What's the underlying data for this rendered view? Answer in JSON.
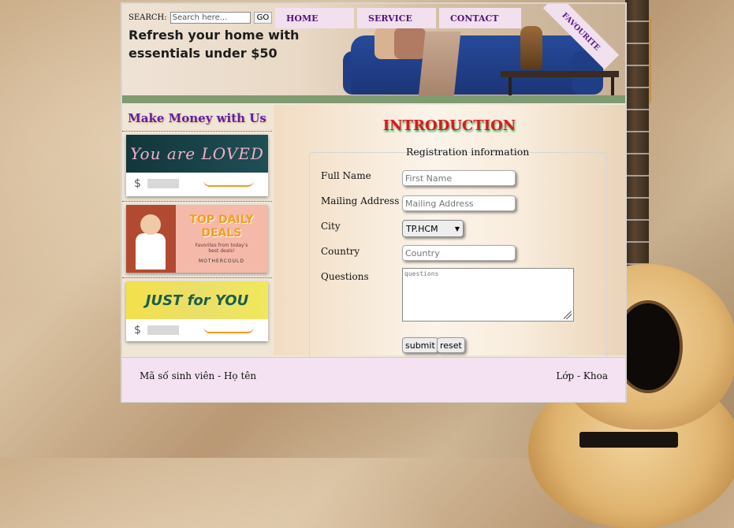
{
  "search": {
    "label": "SEARCH:",
    "placeholder": "Search here...",
    "button": "GO"
  },
  "nav": {
    "items": [
      {
        "label": "HOME"
      },
      {
        "label": "SERVICE"
      },
      {
        "label": "CONTACT"
      }
    ]
  },
  "banner": {
    "line1": "Refresh your home with",
    "line2": "essentials under $50",
    "ribbon": "FAVOURITE"
  },
  "sidebar": {
    "title": "Make Money with Us",
    "ads": [
      {
        "text": "You are LOVED",
        "currency": "$"
      },
      {
        "title_line1": "TOP DAILY",
        "title_line2": "DEALS",
        "subtitle": "Favorites from today's best deals!",
        "brand": "MOTHERCOULD"
      },
      {
        "text": "JUST for YOU",
        "currency": "$"
      }
    ]
  },
  "main": {
    "title": "INTRODUCTION",
    "form": {
      "legend": "Registration information",
      "full_name_label": "Full Name",
      "full_name_placeholder": "First Name",
      "address_label": "Mailing Address",
      "address_placeholder": "Mailing Address",
      "city_label": "City",
      "city_value": "TP.HCM",
      "country_label": "Country",
      "country_placeholder": "Country",
      "questions_label": "Questions",
      "questions_placeholder": "questions",
      "submit": "submit",
      "reset": "reset"
    }
  },
  "footer": {
    "left": "Mã số sinh viên - Họ tên",
    "right": "Lớp - Khoa"
  },
  "colors": {
    "nav_bg": "#f2e0ef",
    "nav_text": "#52157a",
    "title_red": "#e1151c",
    "footer_bg": "#f4e2f2",
    "sidebar_title": "#5a1fae"
  }
}
